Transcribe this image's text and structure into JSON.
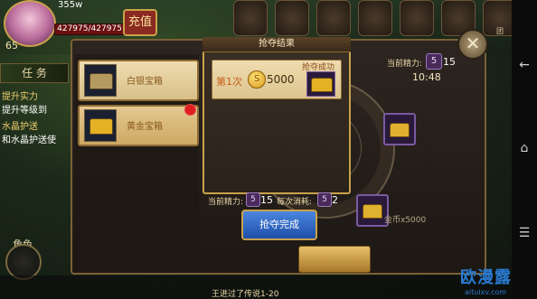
{
  "hud": {
    "level": "65",
    "resource": "355w",
    "hp": "427975/427975",
    "recharge": "充值",
    "top_icons": [
      "",
      "",
      "",
      "",
      "",
      "",
      "团"
    ]
  },
  "sidebar": {
    "task_tab": "任 务",
    "quests": [
      {
        "text": "提升实力",
        "color": "yellow"
      },
      {
        "text": "提升等级到",
        "color": "white"
      },
      {
        "text": "水晶护送",
        "color": "yellow"
      },
      {
        "text": "和水晶护送使",
        "color": "white"
      }
    ],
    "role_label": "角色"
  },
  "chests": [
    {
      "name": "白银宝箱",
      "selected": false
    },
    {
      "name": "黄金宝箱",
      "selected": true
    }
  ],
  "status": {
    "current_energy_label": "当前精力:",
    "current_energy_value": "15",
    "time": "10:48"
  },
  "result": {
    "title": "抢夺结果",
    "rank": "第1次",
    "coin_amount": "5000",
    "success": "抢夺成功"
  },
  "stats": {
    "current_energy_label": "当前精力:",
    "current_energy_value": "15",
    "cost_label": "每次消耗:",
    "cost_value": "2"
  },
  "buttons": {
    "complete": "抢夺完成",
    "close": "✕"
  },
  "background_text": {
    "reward": "金币x5000",
    "bottom": "王进过了传说1-20"
  },
  "watermark": {
    "main": "欧漫露",
    "sub": "aituixv.com"
  },
  "nav": {
    "back": "←",
    "home": "⌂",
    "menu": "☰"
  },
  "colors": {
    "accent_gold": "#c9a24a",
    "button_blue": "#1f4fa8",
    "alert_red": "#e01e1e"
  }
}
